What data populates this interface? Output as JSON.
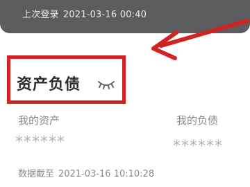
{
  "header": {
    "last_login_label": "上次登录",
    "last_login_time": "2021-03-16 00:40"
  },
  "assets_section": {
    "title": "资产负债",
    "visibility_icon": "closed-eye-icon",
    "my_assets_label": "我的资产",
    "my_assets_value": "******",
    "my_liabilities_label": "我的负债",
    "my_liabilities_value": "******",
    "data_as_of_label": "数据截至",
    "data_as_of_time": "2021-03-16 10:10:28"
  },
  "annotations": {
    "arrow_color": "#d22323",
    "highlight_color": "#d22323"
  }
}
